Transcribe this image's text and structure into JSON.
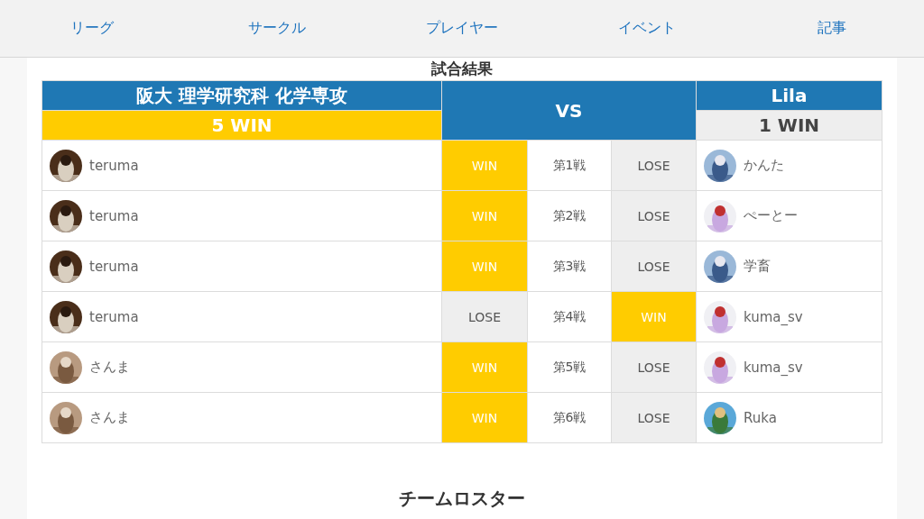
{
  "nav": [
    {
      "label": "リーグ"
    },
    {
      "label": "サークル"
    },
    {
      "label": "プレイヤー"
    },
    {
      "label": "イベント"
    },
    {
      "label": "記事"
    }
  ],
  "section_title": "試合結果",
  "teams": {
    "left": {
      "name": "阪大 理学研究科 化学専攻",
      "score": "5 WIN",
      "winner": true
    },
    "vs": "VS",
    "right": {
      "name": "Lila",
      "score": "1 WIN",
      "winner": false
    }
  },
  "matches": [
    {
      "game": "第1戦",
      "left": {
        "player": "teruma",
        "result": "WIN",
        "won": true
      },
      "right": {
        "player": "かんた",
        "result": "LOSE",
        "won": false
      }
    },
    {
      "game": "第2戦",
      "left": {
        "player": "teruma",
        "result": "WIN",
        "won": true
      },
      "right": {
        "player": "ぺーとー",
        "result": "LOSE",
        "won": false
      }
    },
    {
      "game": "第3戦",
      "left": {
        "player": "teruma",
        "result": "WIN",
        "won": true
      },
      "right": {
        "player": "学畜",
        "result": "LOSE",
        "won": false
      }
    },
    {
      "game": "第4戦",
      "left": {
        "player": "teruma",
        "result": "LOSE",
        "won": false
      },
      "right": {
        "player": "kuma_sv",
        "result": "WIN",
        "won": true
      }
    },
    {
      "game": "第5戦",
      "left": {
        "player": "さんま",
        "result": "WIN",
        "won": true
      },
      "right": {
        "player": "kuma_sv",
        "result": "LOSE",
        "won": false
      }
    },
    {
      "game": "第6戦",
      "left": {
        "player": "さんま",
        "result": "WIN",
        "won": true
      },
      "right": {
        "player": "Ruka",
        "result": "LOSE",
        "won": false
      }
    }
  ],
  "roster_title": "チームロスター"
}
